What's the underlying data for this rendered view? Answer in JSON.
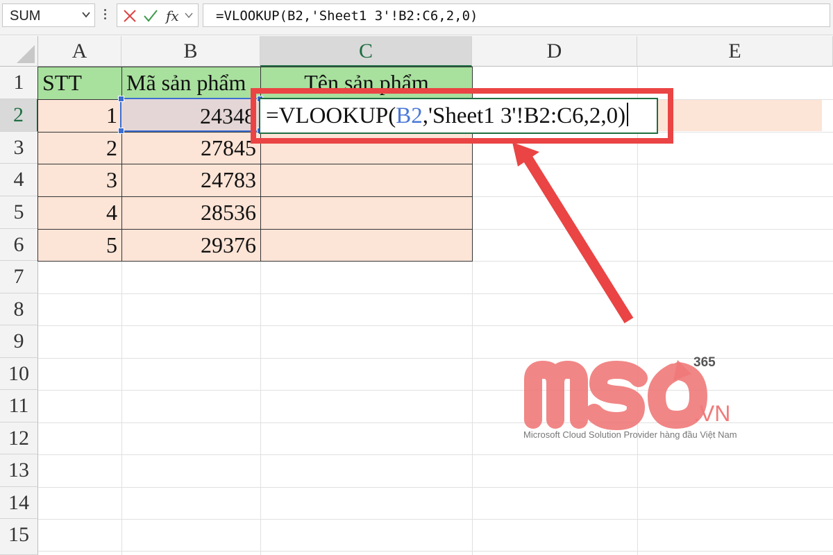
{
  "name_box": {
    "value": "SUM"
  },
  "formula_bar": {
    "cancel_icon": "cancel-x-icon",
    "enter_icon": "check-icon",
    "fx_label": "fx",
    "formula": "=VLOOKUP(B2,'Sheet1 3'!B2:C6,2,0)"
  },
  "columns": [
    "A",
    "B",
    "C",
    "D",
    "E"
  ],
  "rows": [
    "1",
    "2",
    "3",
    "4",
    "5",
    "6",
    "7",
    "8",
    "9",
    "10",
    "11",
    "12",
    "13",
    "14",
    "15"
  ],
  "table": {
    "headers": [
      "STT",
      "Mã sản phẩm",
      "Tên sản phẩm"
    ],
    "stt": [
      "1",
      "2",
      "3",
      "4",
      "5"
    ],
    "codes": [
      "24348",
      "27845",
      "24783",
      "28536",
      "29376"
    ]
  },
  "editing_cell": {
    "prefix": "=VLOOKUP(",
    "ref": "B2",
    "suffix": ",'Sheet1 3'!B2:C6,2,0)"
  },
  "colors": {
    "header_fill": "#a8e09e",
    "data_fill": "#fce4d6",
    "callout": "#ea4444",
    "selection": "#3c6ed2",
    "active": "#1e6e42"
  },
  "watermark": {
    "brand": "MSO",
    "superscript": "365",
    "domain": ".VN",
    "tagline": "Microsoft Cloud Solution Provider hàng đầu Việt Nam"
  }
}
